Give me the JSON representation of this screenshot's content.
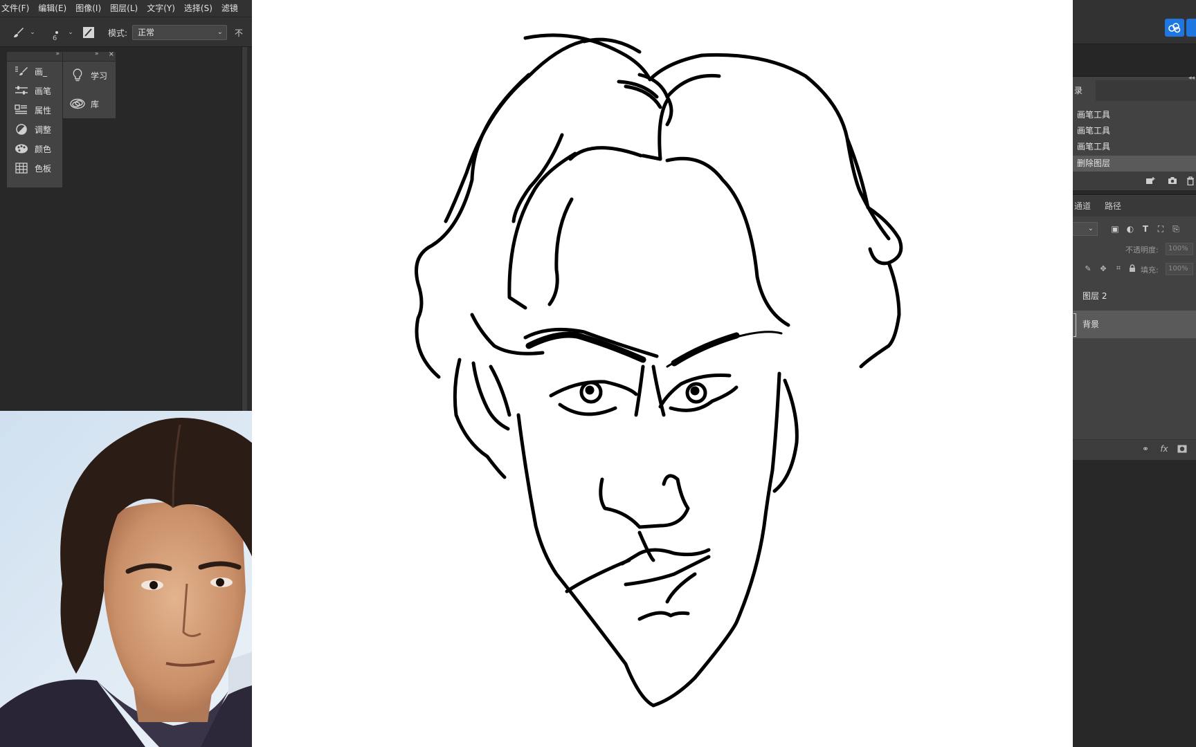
{
  "menubar": {
    "items": [
      "文件(F)",
      "编辑(E)",
      "图像(I)",
      "图层(L)",
      "文字(Y)",
      "选择(S)",
      "滤镜"
    ]
  },
  "options_bar": {
    "brush_size": "6",
    "mode_label": "模式:",
    "mode_value": "正常",
    "opacity_label_cut": "不"
  },
  "dock": {
    "col1": [
      {
        "label": "画_",
        "icon": "brush-presets-icon"
      },
      {
        "label": "画笔",
        "icon": "brush-settings-icon"
      },
      {
        "label": "属性",
        "icon": "properties-icon"
      },
      {
        "label": "调整",
        "icon": "adjustments-icon"
      },
      {
        "label": "颜色",
        "icon": "color-palette-icon"
      },
      {
        "label": "色板",
        "icon": "swatches-icon"
      }
    ],
    "col2": [
      {
        "label": "学习",
        "icon": "lightbulb-icon"
      },
      {
        "label": "库",
        "icon": "libraries-icon"
      }
    ]
  },
  "history": {
    "tab_label": "录",
    "items": [
      "画笔工具",
      "画笔工具",
      "画笔工具",
      "删除图层"
    ],
    "selected_index": 3
  },
  "layers": {
    "tabs": [
      "通道",
      "路径"
    ],
    "opacity_label": "不透明度:",
    "opacity_value": "100%",
    "fill_label": "填充:",
    "fill_value": "100%",
    "items": [
      {
        "name": "图层 2"
      },
      {
        "name": "背景"
      }
    ],
    "selected_index": 1
  },
  "colors": {
    "ui_dark": "#282828",
    "panel": "#424242",
    "accent": "#1e76e0"
  }
}
